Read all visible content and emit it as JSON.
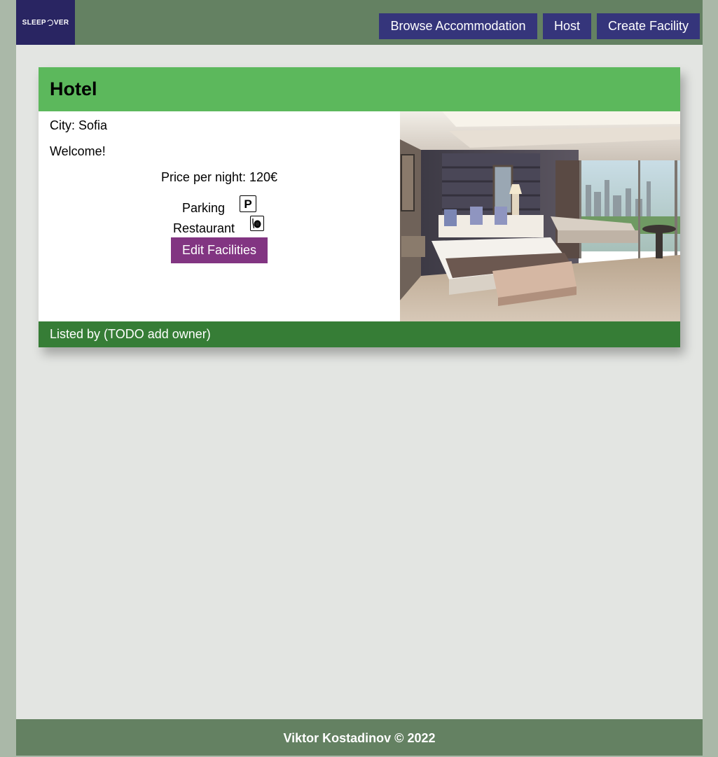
{
  "header": {
    "logo_text_left": "SLEEP",
    "logo_text_right": "VER",
    "nav": [
      {
        "label": "Browse Accommodation"
      },
      {
        "label": "Host"
      },
      {
        "label": "Create Facility"
      }
    ]
  },
  "listing": {
    "title": "Hotel",
    "city": "City: Sofia",
    "description": "Welcome!",
    "price": "Price per night: 120€",
    "facilities": [
      {
        "label": "Parking",
        "icon": "parking-icon"
      },
      {
        "label": "Restaurant",
        "icon": "restaurant-icon"
      }
    ],
    "edit_label": "Edit Facilities",
    "listed_by": "Listed by (TODO add owner)"
  },
  "footer": {
    "text": "Viktor Kostadinov © 2022"
  },
  "colors": {
    "topbar": "#648162",
    "logo_bg": "#292562",
    "nav_button": "#35357b",
    "card_header": "#5cb85c",
    "card_footer": "#367d36",
    "edit_button": "#823582",
    "page_bg": "#e3e5e2",
    "outer_bg": "#aab8a8"
  }
}
